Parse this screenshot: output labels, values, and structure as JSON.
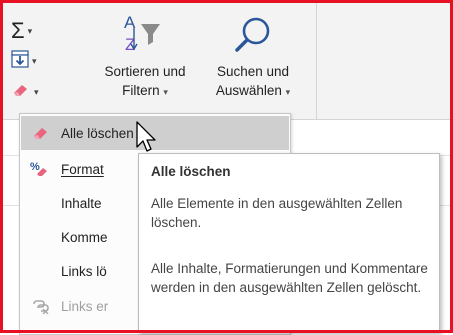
{
  "ribbon": {
    "autosum": {
      "glyph": "Σ",
      "icon": "autosum-icon"
    },
    "fill": {
      "icon": "fill-down-icon"
    },
    "clear": {
      "icon": "eraser-icon"
    },
    "sort_filter": {
      "label_line1": "Sortieren und",
      "label_line2": "Filtern",
      "icon": "sort-az-filter-icon",
      "glyph_a": "A",
      "glyph_z": "Z"
    },
    "find_select": {
      "label_line1": "Suchen und",
      "label_line2": "Auswählen",
      "icon": "magnifier-icon"
    }
  },
  "clear_menu": {
    "items": [
      {
        "label": "Alle löschen",
        "icon": "eraser-icon",
        "state": "hover"
      },
      {
        "label": "Format",
        "icon": "clear-formats-icon",
        "state": "normal"
      },
      {
        "label": "Inhalte",
        "icon": "none",
        "state": "normal"
      },
      {
        "label": "Komme",
        "icon": "none",
        "state": "normal"
      },
      {
        "label": "Links lö",
        "icon": "none",
        "state": "normal"
      },
      {
        "label": "Links er",
        "icon": "remove-hyperlink-icon",
        "state": "disabled"
      }
    ]
  },
  "tooltip": {
    "title": "Alle löschen",
    "paragraph1": "Alle Elemente in den ausgewählten Zellen löschen.",
    "paragraph2": "Alle Inhalte, Formatierungen und Kommentare werden in den ausgewählten Zellen gelöscht."
  },
  "colors": {
    "frame": "#e81123",
    "ribbon_bg": "#f3f3f3",
    "hover_bg": "#cfcfcf",
    "accent_blue": "#2b579a",
    "eraser_pink": "#e8657d"
  }
}
